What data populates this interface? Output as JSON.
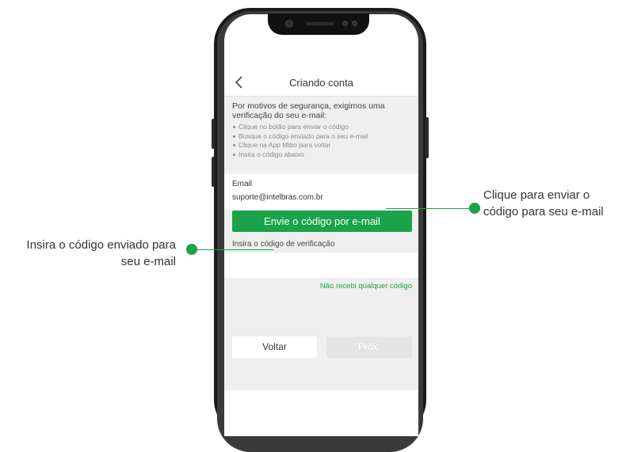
{
  "app": {
    "title": "Criando conta",
    "info_heading": "Por motivos de segurança, exigimos uma verificação do seu e-mail:",
    "bullets": [
      "Clique no botão para enviar o código",
      "Busque o código enviado para o seu e-mail",
      "Clique na App Mibo para voltar",
      "Insira o código abaixo"
    ],
    "email_label": "Email",
    "email_value": "suporte@intelbras.com.br",
    "send_button": "Envie o código por e-mail",
    "code_label": "Insira o código de verificação",
    "code_value": "",
    "no_code_link": "Não recebi qualquer código",
    "back_button": "Voltar",
    "next_button": "Próx."
  },
  "callouts": {
    "right_line1": "Clique para enviar o",
    "right_line2": "código para seu e-mail",
    "left_line1": "Insira o código enviado para",
    "left_line2": "seu e-mail"
  },
  "colors": {
    "accent": "#1aa34a",
    "screen_bg": "#efefef",
    "frame": "#1b1b1b"
  },
  "icons": [
    "back-chevron-icon",
    "front-camera-icon",
    "speaker-icon"
  ]
}
